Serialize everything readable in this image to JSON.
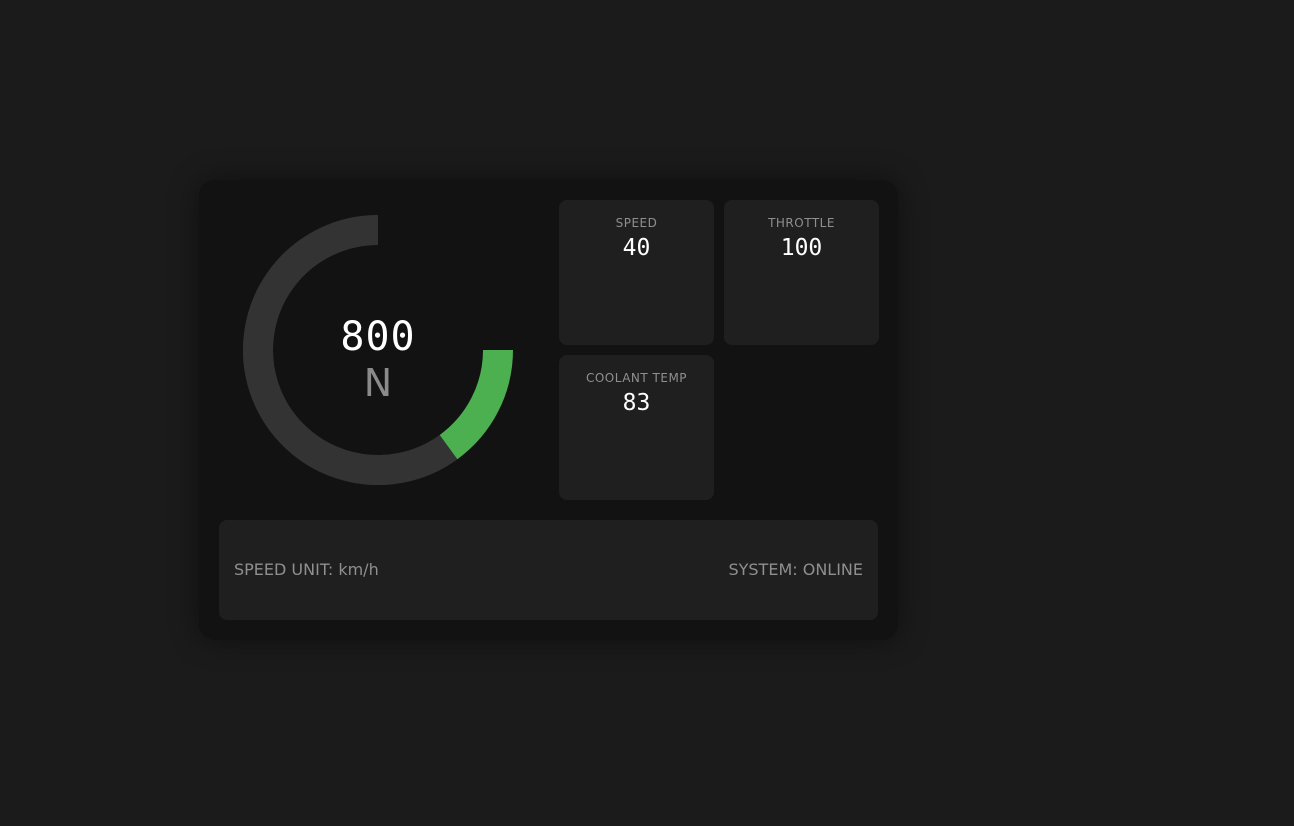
{
  "colors": {
    "background": "#1b1b1b",
    "panel": "#121212",
    "tile": "#1f1f1f",
    "gauge_track": "#333333",
    "gauge_fill": "#4caf50"
  },
  "gauge": {
    "rpm": "800",
    "gear": "N",
    "fill_start_fraction": 0.75,
    "fill_end_fraction": 0.9
  },
  "tiles": {
    "speed": {
      "label": "SPEED",
      "value": "40"
    },
    "throttle": {
      "label": "THROTTLE",
      "value": "100"
    },
    "coolant": {
      "label": "COOLANT TEMP",
      "value": "83"
    }
  },
  "footer": {
    "speed_unit": "SPEED UNIT: km/h",
    "system_status": "SYSTEM: ONLINE"
  }
}
